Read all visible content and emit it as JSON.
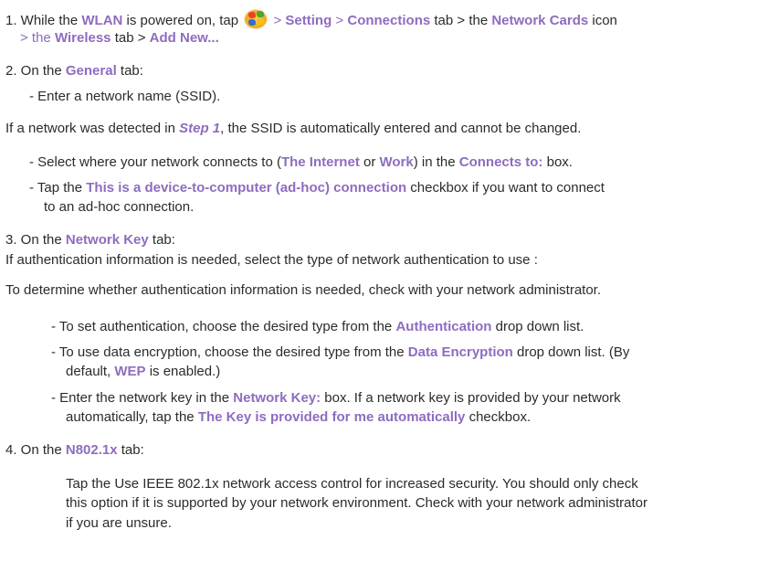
{
  "step1": {
    "l1": {
      "a": "1. While the ",
      "b": "WLAN",
      "c": " is powered on, tap ",
      "d": " > ",
      "e": "Setting",
      "f": " > ",
      "g": "Connections",
      "h": " tab > the ",
      "i": "Network Cards",
      "j": " icon"
    },
    "l2": {
      "a": "> the ",
      "b": "Wireless",
      "c": " tab > ",
      "d": "Add New..."
    },
    "start_icon": "windows-start-icon"
  },
  "step2": {
    "l1": {
      "a": "2. On the ",
      "b": "General",
      "c": " tab:"
    },
    "l2": "-   Enter a network name (SSID).",
    "l3": {
      "a": "If a network was detected in ",
      "b": "Step 1",
      "c": ", the SSID is automatically entered and cannot be changed."
    },
    "l4": {
      "a": "-   Select where your network connects to (",
      "b": "The Internet",
      "c": " or ",
      "d": "Work",
      "e": ") in the ",
      "f": "Connects to:",
      "g": " box."
    },
    "l5": {
      "a": "-   Tap the ",
      "b": "This is a device-to-computer (ad-hoc) connection",
      "c": " checkbox if you want to connect"
    },
    "l6": "to an ad-hoc connection."
  },
  "step3": {
    "l1": {
      "a": "3. On the ",
      "b": "Network Key",
      "c": " tab:"
    },
    "l2": "If authentication information is needed, select the type of network authentication to use :",
    "l3": "To determine whether authentication information is needed, check with your network administrator.",
    "l4": {
      "a": "-   To set authentication, choose the desired type from the ",
      "b": "Authentication",
      "c": " drop down list."
    },
    "l5": {
      "a": "-   To use data encryption, choose the desired type from the ",
      "b": "Data Encryption",
      "c": " drop down list. (By"
    },
    "l6": {
      "a": "default, ",
      "b": "WEP",
      "c": " is enabled.)"
    },
    "l7": {
      "a": "-   Enter the network key in the ",
      "b": "Network Key:",
      "c": " box. If a network key is provided by your network"
    },
    "l8": {
      "a": "automatically, tap the ",
      "b": "The Key is provided for me automatically",
      "c": " checkbox."
    }
  },
  "step4": {
    "l1": {
      "a": "4. On the ",
      "b": "N802.1x",
      "c": " tab:"
    },
    "l2": "Tap the Use IEEE 802.1x network access control for increased security. You should only check",
    "l3": "this option if it is supported by your network environment. Check with your network administrator",
    "l4": "if you are unsure."
  }
}
